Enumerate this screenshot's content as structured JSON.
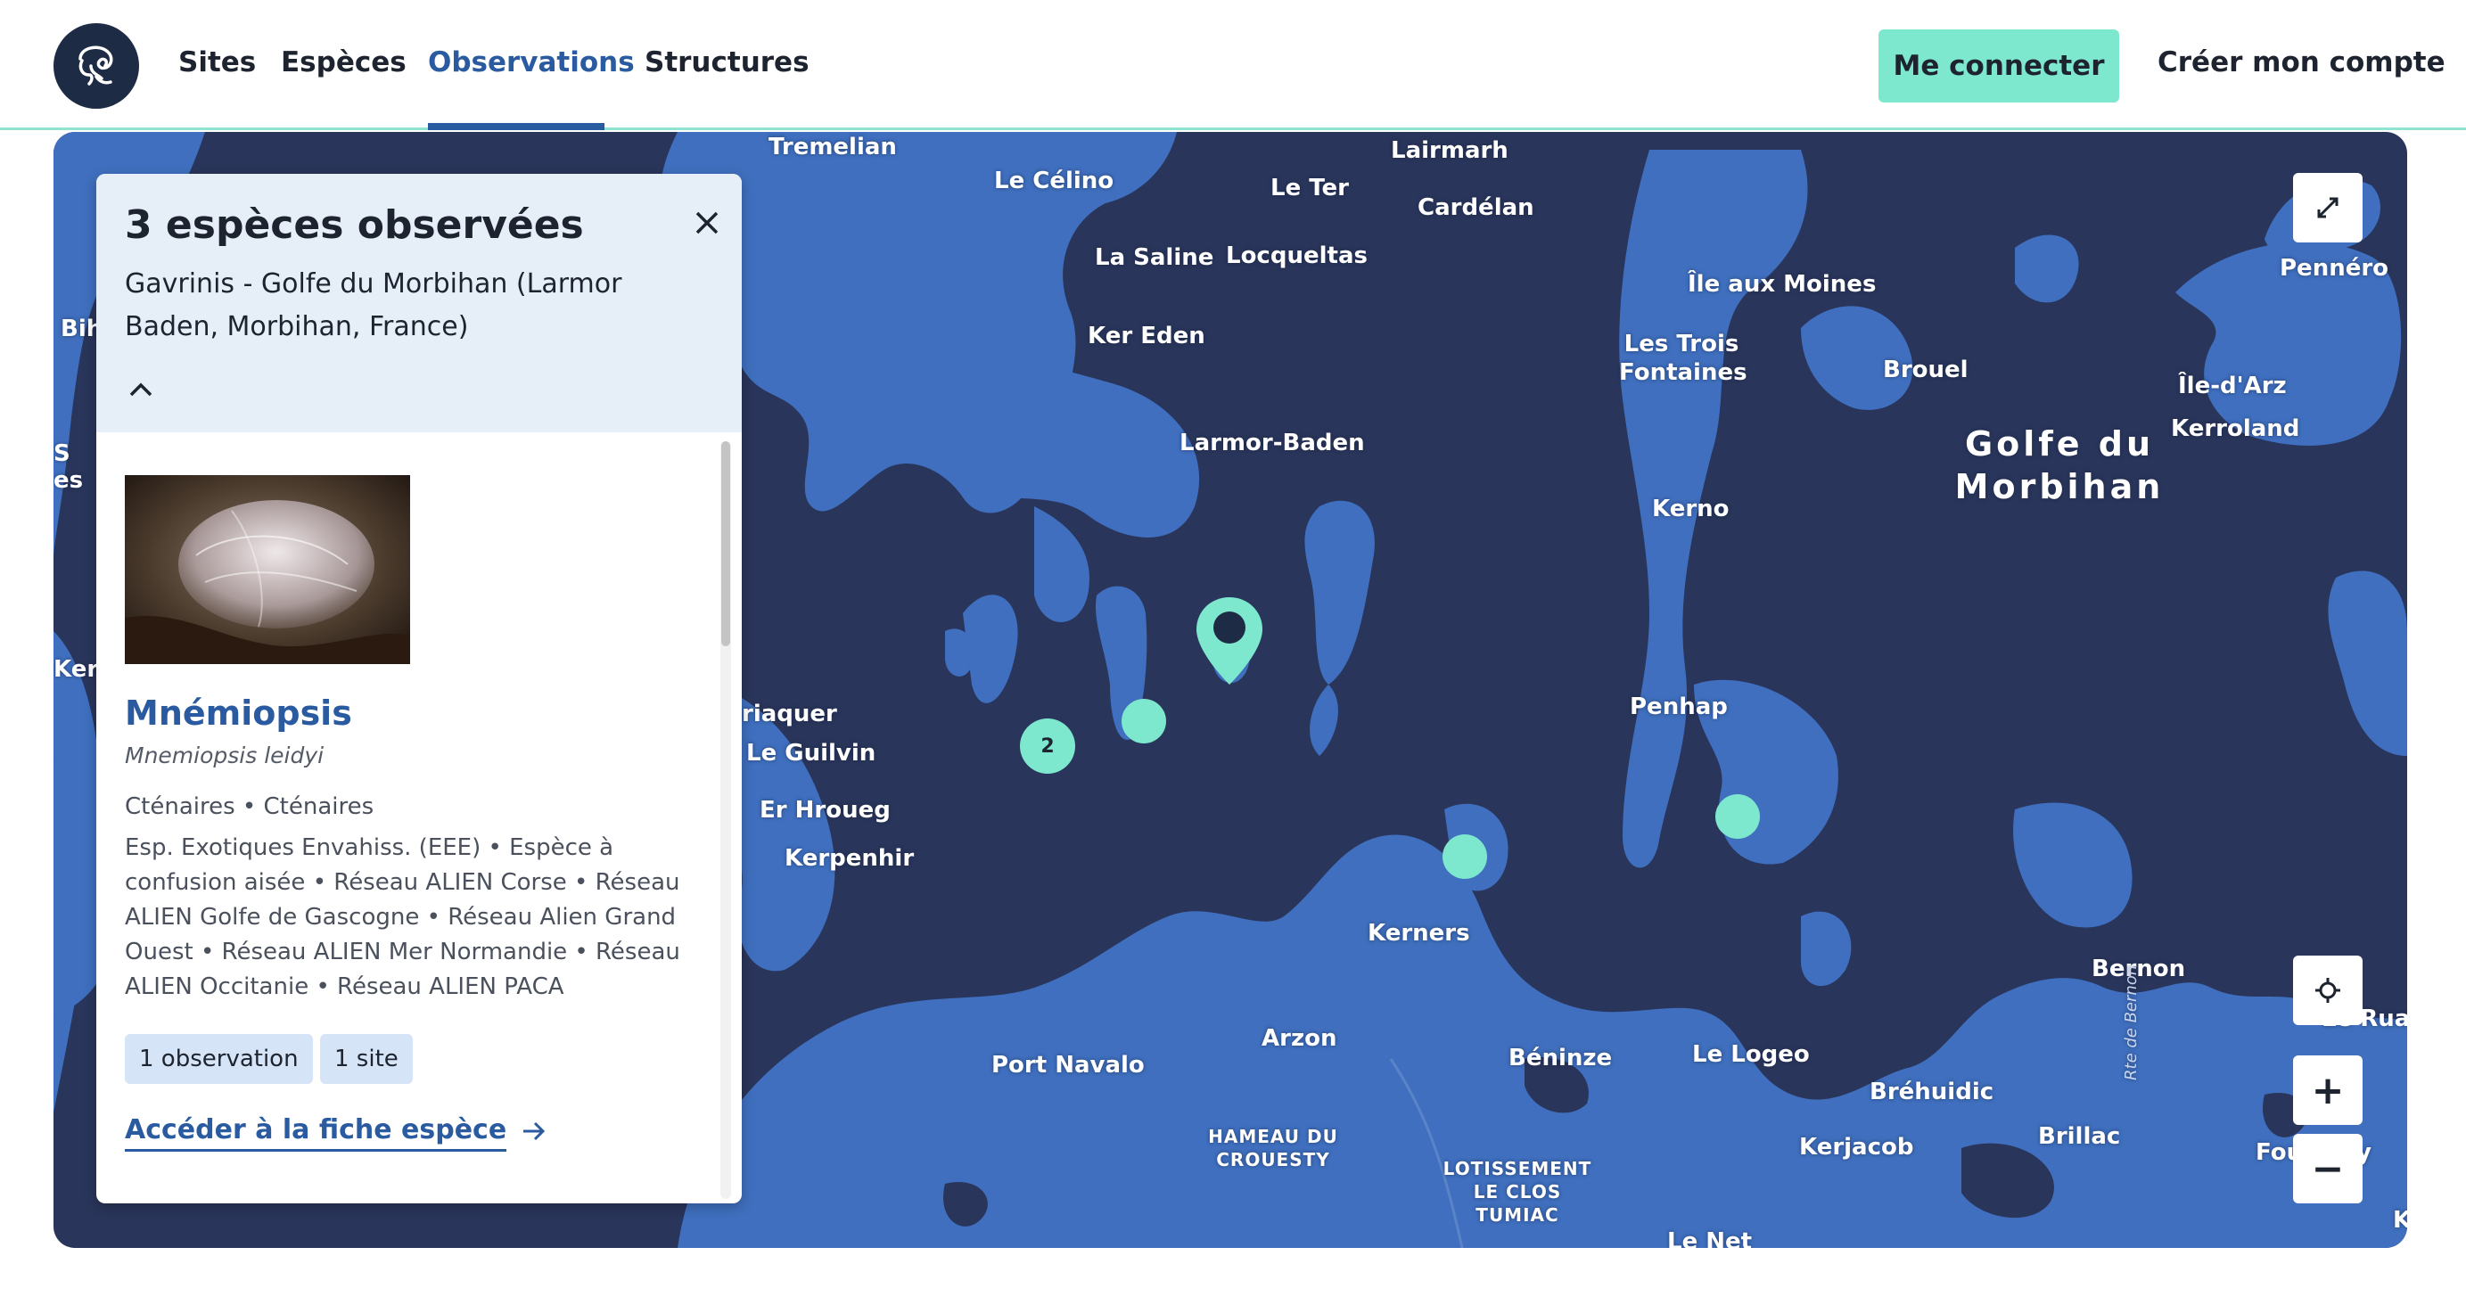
{
  "nav": {
    "logo_icon": "jellyfish-logo-icon",
    "items": [
      {
        "label": "Sites",
        "active": false
      },
      {
        "label": "Espèces",
        "active": false
      },
      {
        "label": "Observations",
        "active": true
      },
      {
        "label": "Structures",
        "active": false
      }
    ],
    "login_label": "Me connecter",
    "signup_label": "Créer mon compte"
  },
  "colors": {
    "accent": "#7ee8cf",
    "primary": "#2a5aa0",
    "map_water": "#29355a",
    "map_land": "#3f6fbe"
  },
  "map": {
    "places": [
      "Tremelian",
      "Le Célino",
      "Le Ter",
      "Lairmarh",
      "Cardélan",
      "La Saline",
      "Locqueltas",
      "Ker Eden",
      "Île aux Moines",
      "Les Trois Fontaines",
      "Brouel",
      "Pennéro",
      "Île-d'Arz",
      "Kerroland",
      "Larmor-Baden",
      "Kerno",
      "Penhap",
      "riaquer",
      "Le Guilvin",
      "Er Hroueg",
      "Kerpenhir",
      "Kerners",
      "Bernon",
      "Arzon",
      "Port Navalo",
      "Béninze",
      "Le Logeo",
      "Bréhuidic",
      "Kerjacob",
      "Brillac",
      "HAMEAU DU CROUESTY",
      "LOTISSEMENT LE CLOS TUMIAC",
      "Le Net",
      "Biho",
      "es",
      "Kern",
      "Le Ruau",
      "Fou",
      "y",
      "K",
      "S",
      "Rte de Bernon"
    ],
    "gulf_label": "Golfe du Morbihan",
    "cluster_count": "2",
    "controls": {
      "fullscreen_icon": "expand-icon",
      "locate_icon": "crosshair-icon",
      "zoom_in": "+",
      "zoom_out": "−"
    }
  },
  "panel": {
    "title": "3 espèces observées",
    "location": "Gavrinis - Golfe du Morbihan (Larmor Baden, Morbihan, France)",
    "close_icon": "close-icon",
    "collapse_icon": "chevron-up-icon",
    "species": {
      "name": "Mnémiopsis",
      "latin": "Mnemiopsis leidyi",
      "group": "Cténaires • Cténaires",
      "tags": "Esp. Exotiques Envahiss. (EEE) • Espèce à confusion aisée • Réseau ALIEN Corse • Réseau ALIEN Golfe de Gascogne • Réseau Alien Grand Ouest • Réseau ALIEN Mer Normandie • Réseau ALIEN Occitanie • Réseau ALIEN PACA",
      "observations_chip": "1 observation",
      "sites_chip": "1 site",
      "link_label": "Accéder à la fiche espèce",
      "link_icon": "arrow-right-icon"
    }
  }
}
